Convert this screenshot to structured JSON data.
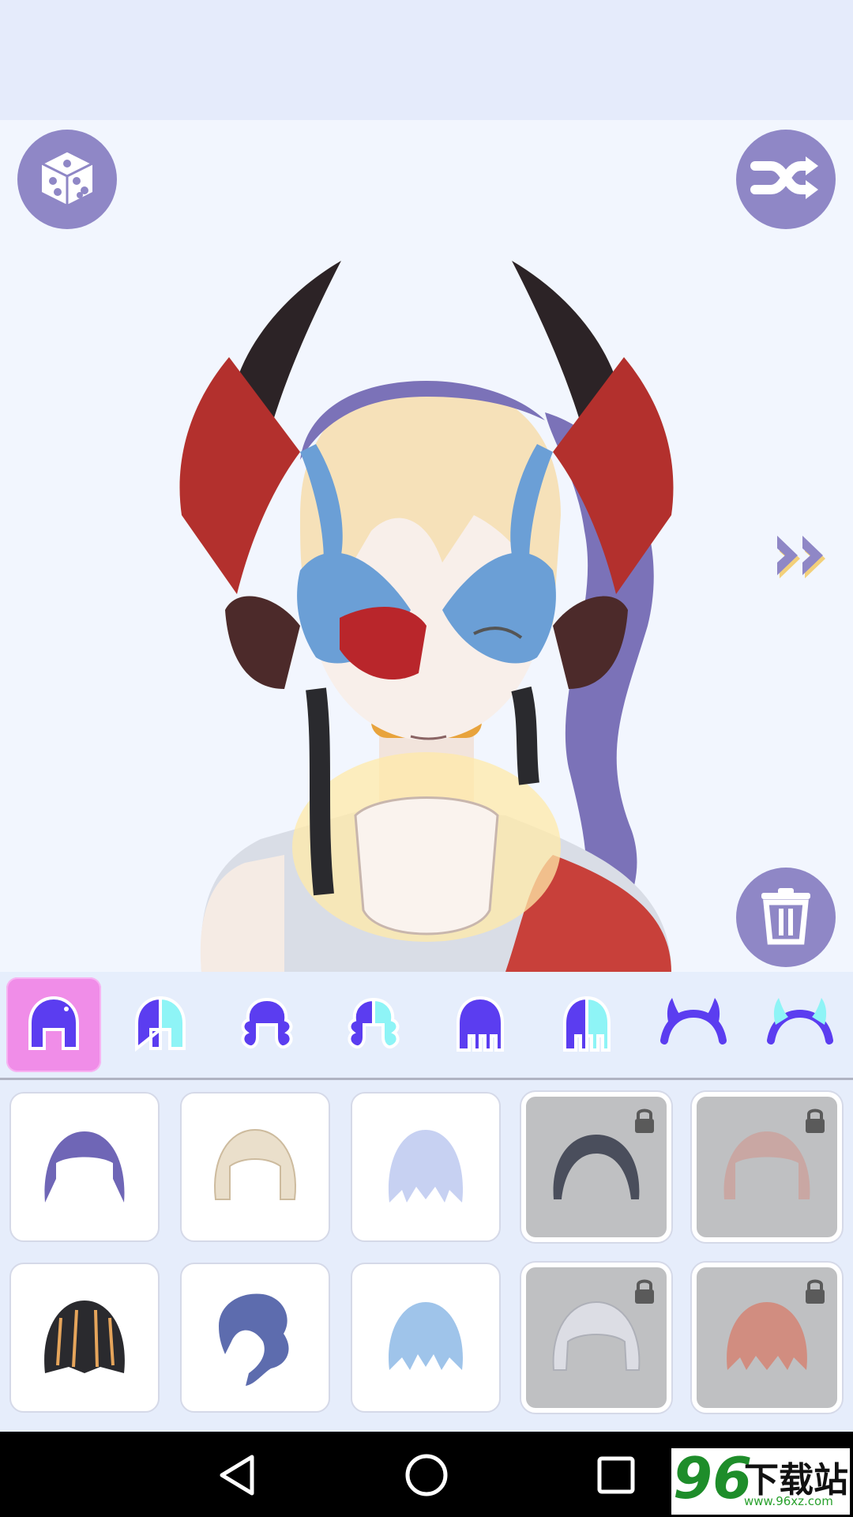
{
  "app": {
    "accent_color": "#8f87c6",
    "active_tab_color": "#f08de8",
    "icon_color": "#5b3df0"
  },
  "toolbar": {
    "random_icon": "dice-icon",
    "shuffle_icon": "shuffle-icon",
    "next_icon": "double-chevron-right-icon",
    "delete_icon": "trash-icon"
  },
  "category_tabs": [
    {
      "icon": "hair-full-icon",
      "selected": true
    },
    {
      "icon": "hair-full-highlight-icon",
      "selected": false
    },
    {
      "icon": "hair-curly-icon",
      "selected": false
    },
    {
      "icon": "hair-curly-highlight-icon",
      "selected": false
    },
    {
      "icon": "hair-straight-icon",
      "selected": false
    },
    {
      "icon": "hair-straight-highlight-icon",
      "selected": false
    },
    {
      "icon": "horns-icon",
      "selected": false
    },
    {
      "icon": "horns-highlight-icon",
      "selected": false
    }
  ],
  "hair_items": [
    {
      "color": "#6f66b6",
      "locked": false
    },
    {
      "color": "#eadfcb",
      "locked": false
    },
    {
      "color": "#c7d1f2",
      "locked": false
    },
    {
      "color": "#4a4e5c",
      "locked": true
    },
    {
      "color": "#c9a7a3",
      "locked": true
    },
    {
      "color": "#2a2a2e",
      "locked": false
    },
    {
      "color": "#5d6cae",
      "locked": false
    },
    {
      "color": "#9fc4ea",
      "locked": false
    },
    {
      "color": "#dcdde4",
      "locked": true
    },
    {
      "color": "#d18d80",
      "locked": true
    }
  ],
  "nav": {
    "back_icon": "back-triangle-icon",
    "home_icon": "home-circle-icon",
    "recents_icon": "recents-square-icon"
  },
  "watermark": {
    "number": "96",
    "text": "下载站",
    "url": "www.96xz.com"
  }
}
